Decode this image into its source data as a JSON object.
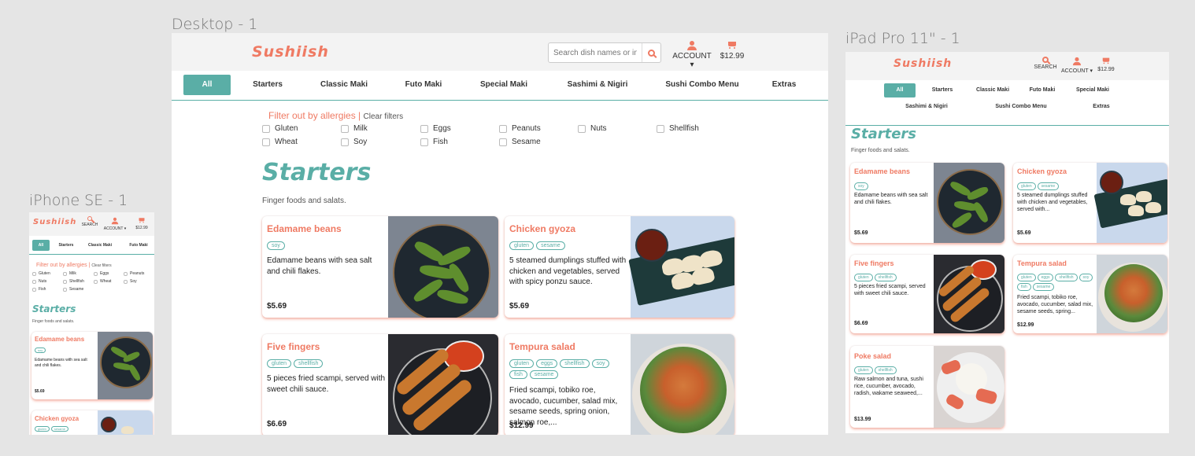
{
  "frames": {
    "desktop_label": "Desktop - 1",
    "ipad_label": "iPad Pro 11\" - 1",
    "iphone_label": "iPhone SE - 1"
  },
  "header": {
    "logo": "Sushiish",
    "search_placeholder": "Search dish names or ingredients",
    "search_label": "SEARCH",
    "account_label": "ACCOUNT ▾",
    "cart_total": "$12.99"
  },
  "categories": [
    "All",
    "Starters",
    "Classic Maki",
    "Futo Maki",
    "Special Maki",
    "Sashimi & Nigiri",
    "Sushi Combo Menu",
    "Extras"
  ],
  "filter": {
    "title": "Filter out by allergies |",
    "clear": "Clear filters",
    "allergens_desktop": [
      "Gluten",
      "Milk",
      "Eggs",
      "Peanuts",
      "Nuts",
      "Shellfish",
      "Wheat",
      "Soy",
      "Fish",
      "Sesame"
    ],
    "allergens_phone": [
      "Gluten",
      "Milk",
      "Eggs",
      "Peanuts",
      "Nuts",
      "Shellfish",
      "Wheat",
      "Soy",
      "Fish",
      "Sesame"
    ]
  },
  "section": {
    "title": "Starters",
    "subtitle": "Finger foods and salats."
  },
  "dishes": [
    {
      "name": "Edamame beans",
      "tags": [
        "soy"
      ],
      "desc": "Edamame beans with sea salt and chili flakes.",
      "price": "$5.69"
    },
    {
      "name": "Chicken gyoza",
      "tags": [
        "gluten",
        "sesame"
      ],
      "desc": "5 steamed dumplings stuffed with chicken and vegetables, served with spicy ponzu sauce.",
      "desc_short": "5 steamed dumplings stuffed with chicken and vegetables, served with...",
      "price": "$5.69"
    },
    {
      "name": "Five fingers",
      "tags": [
        "gluten",
        "shellfish"
      ],
      "desc": "5 pieces fried scampi, served with sweet chili sauce.",
      "price": "$6.69"
    },
    {
      "name": "Tempura salad",
      "tags": [
        "gluten",
        "eggs",
        "shellfish",
        "soy",
        "fish",
        "sesame"
      ],
      "desc": "Fried scampi, tobiko roe, avocado, cucumber, salad mix, sesame seeds, spring onion, salmon roe,...",
      "desc_short": "Fried scampi, tobiko roe, avocado, cucumber, salad mix, sesame seeds, spring...",
      "price": "$12.99"
    },
    {
      "name": "Poke salad",
      "tags": [
        "gluten",
        "shellfish"
      ],
      "desc": "Raw salmon and tuna, sushi rice, cucumber, avocado, radish, wakame seaweed,...",
      "price": "$13.99"
    }
  ],
  "colors": {
    "accent": "#ef7a63",
    "teal": "#5aaea6",
    "background": "#e5e5e5"
  }
}
